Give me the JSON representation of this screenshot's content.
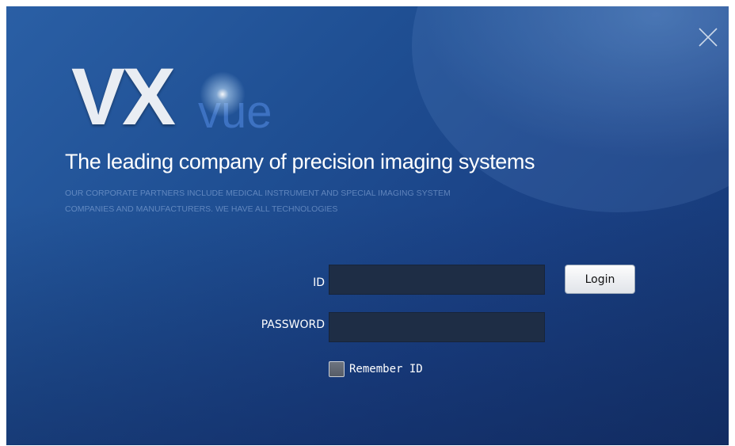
{
  "window": {
    "close_icon": "close-icon"
  },
  "branding": {
    "logo_primary": "VX",
    "logo_secondary": "vue",
    "tagline": "The leading company of precision imaging systems",
    "description_line1": "OUR CORPORATE PARTNERS INCLUDE MEDICAL INSTRUMENT AND SPECIAL IMAGING SYSTEM",
    "description_line2": "COMPANIES AND MANUFACTURERS. WE HAVE ALL TECHNOLOGIES"
  },
  "form": {
    "id_label": "ID",
    "id_value": "",
    "password_label": "PASSWORD",
    "password_value": "",
    "login_button": "Login",
    "remember_label": "Remember ID",
    "remember_checked": false
  },
  "colors": {
    "background_top": "#2a5fa5",
    "background_bottom": "#163670",
    "field_background": "#1e2d45",
    "logo_accent": "#3d72c2"
  }
}
